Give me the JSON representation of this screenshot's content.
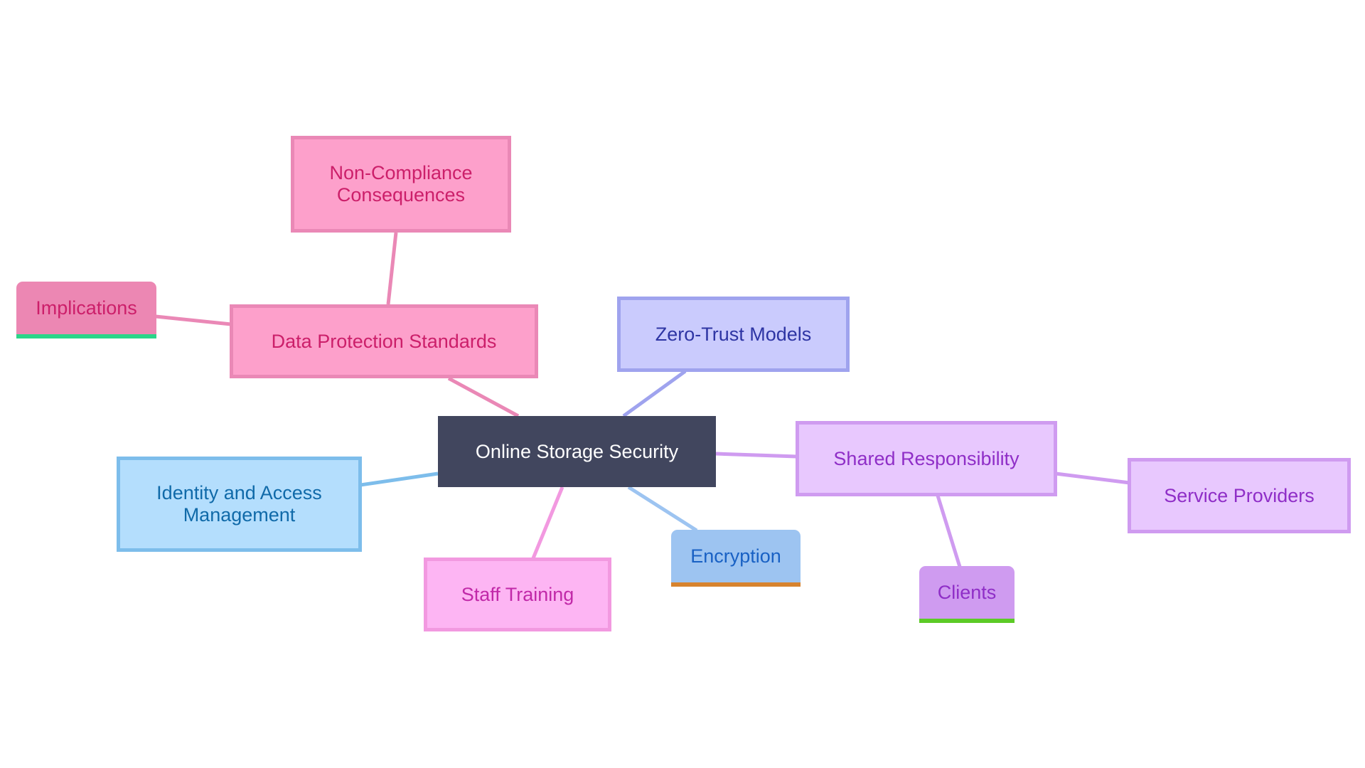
{
  "diagram": {
    "type": "mindmap",
    "root": {
      "id": "root",
      "label": "Online Storage Security"
    },
    "nodes": [
      {
        "id": "dps",
        "label": "Data Protection Standards",
        "parent": "root",
        "line_color": "#ea88b6"
      },
      {
        "id": "ncc",
        "label": "Non-Compliance Consequences",
        "parent": "dps",
        "line_color": "#ea88b6"
      },
      {
        "id": "impl",
        "label": "Implications",
        "parent": "dps",
        "line_color": "#ea88b6"
      },
      {
        "id": "ztm",
        "label": "Zero-Trust Models",
        "parent": "root",
        "line_color": "#9fa3ee"
      },
      {
        "id": "sr",
        "label": "Shared Responsibility",
        "parent": "root",
        "line_color": "#cf9bf0"
      },
      {
        "id": "sp",
        "label": "Service Providers",
        "parent": "sr",
        "line_color": "#cf9bf0"
      },
      {
        "id": "cli",
        "label": "Clients",
        "parent": "sr",
        "line_color": "#cf9bf0"
      },
      {
        "id": "enc",
        "label": "Encryption",
        "parent": "root",
        "line_color": "#9dc4f1"
      },
      {
        "id": "st",
        "label": "Staff Training",
        "parent": "root",
        "line_color": "#f299e0"
      },
      {
        "id": "iam",
        "label": "Identity and Access Management",
        "parent": "root",
        "line_color": "#7dbdeb"
      }
    ],
    "labels": {
      "root": [
        "Online Storage Security"
      ],
      "dps": [
        "Data Protection Standards"
      ],
      "ncc": [
        "Non-Compliance",
        "Consequences"
      ],
      "impl": [
        "Implications"
      ],
      "ztm": [
        "Zero-Trust Models"
      ],
      "sr": [
        "Shared Responsibility"
      ],
      "sp": [
        "Service Providers"
      ],
      "cli": [
        "Clients"
      ],
      "enc": [
        "Encryption"
      ],
      "st": [
        "Staff Training"
      ],
      "iam": [
        "Identity and Access",
        "Management"
      ]
    }
  }
}
